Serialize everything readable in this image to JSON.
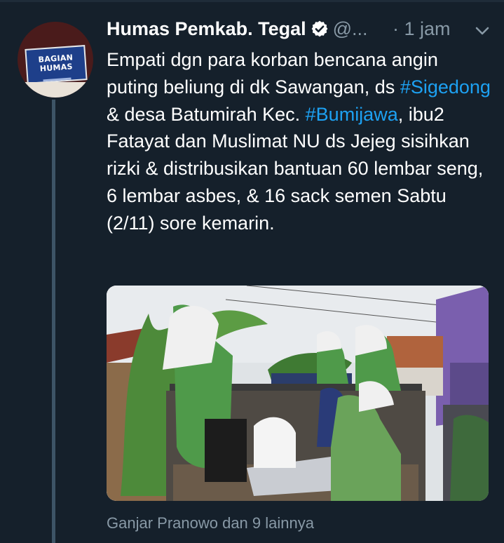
{
  "tweet": {
    "author": {
      "name": "Humas Pemkab. Tegal",
      "handle": "@...",
      "verified": true,
      "avatar_sign_text": "BAGIAN HUMAS"
    },
    "time": "· 1 jam",
    "text_parts": {
      "p1": "Empati dgn para korban bencana angin puting beliung di dk Sawangan, ds ",
      "h1": "#Sigedong",
      "p2": " & desa Batumirah Kec. ",
      "h2": "#Bumijawa",
      "p3": ", ibu2 Fatayat dan Muslimat NU ds Jejeg sisihkan rizki & distribusikan bantuan 60 lembar seng, 6 lembar asbes, & 16 sack semen Sabtu (2/11) sore kemarin."
    },
    "media_description": "photo",
    "likes_summary": "Ganjar Pranowo dan 9 lainnya"
  },
  "colors": {
    "background": "#15202b",
    "text": "#ffffff",
    "secondary_text": "#8899a6",
    "link": "#1da1f2",
    "thread_line": "#3d5466",
    "uniform_green": "#4f9a4a",
    "truck_blue": "#2b3d6b"
  },
  "icons": {
    "verified": "verified-badge-icon",
    "menu": "chevron-down-icon"
  }
}
